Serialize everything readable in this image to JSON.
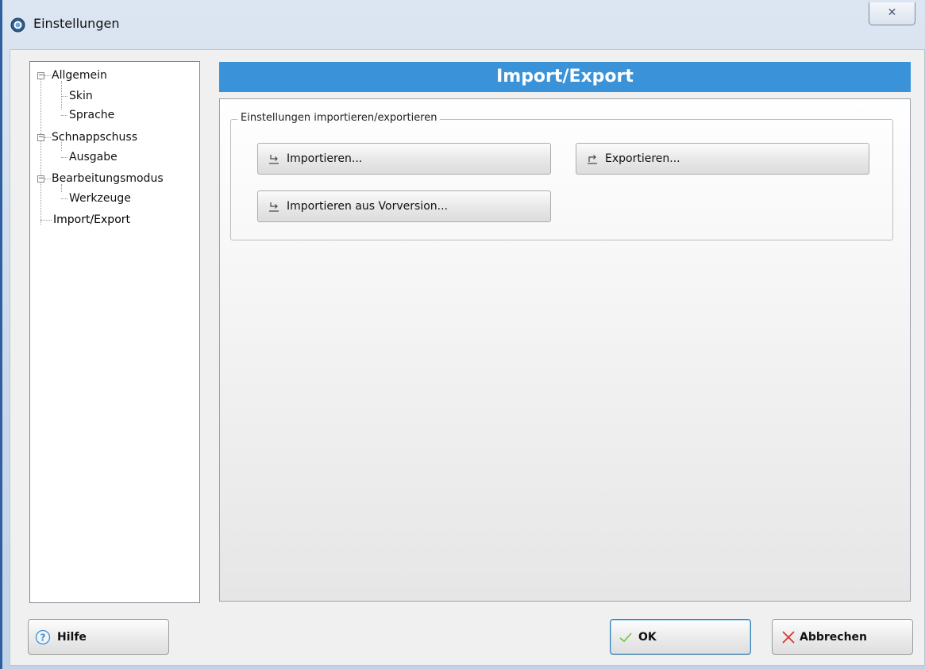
{
  "window": {
    "title": "Einstellungen",
    "close_glyph": "✕"
  },
  "tree": {
    "items": [
      {
        "label": "Allgemein",
        "expanded": true
      },
      {
        "label": "Skin"
      },
      {
        "label": "Sprache"
      },
      {
        "label": "Schnappschuss",
        "expanded": true
      },
      {
        "label": "Ausgabe"
      },
      {
        "label": "Bearbeitungsmodus",
        "expanded": true
      },
      {
        "label": "Werkzeuge"
      },
      {
        "label": "Import/Export",
        "selected": true
      }
    ],
    "collapse_glyph": "−"
  },
  "page": {
    "header": "Import/Export",
    "group_title": "Einstellungen importieren/exportieren",
    "buttons": {
      "import": "Importieren...",
      "export": "Exportieren...",
      "import_previous": "Importieren aus Vorversion..."
    }
  },
  "footer": {
    "help": "Hilfe",
    "ok": "OK",
    "cancel": "Abbrechen",
    "help_glyph": "?"
  },
  "colors": {
    "header_bar": "#3a93d8",
    "ok_check": "#6fbf4a",
    "cancel_x": "#d9312b",
    "help_icon": "#4a8fd0"
  },
  "icons": {
    "app": "app-logo-icon",
    "close": "close-icon",
    "import": "import-arrow-icon",
    "export": "export-arrow-icon",
    "help": "help-circle-icon",
    "ok": "checkmark-icon",
    "cancel": "cancel-x-icon"
  }
}
